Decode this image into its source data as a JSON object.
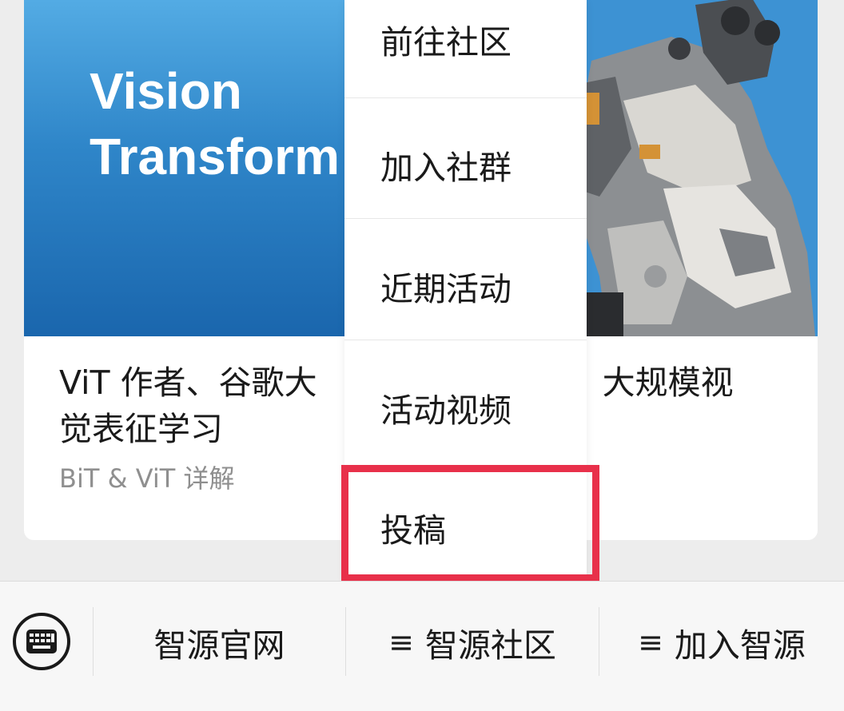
{
  "article": {
    "cover_line1": "Vision",
    "cover_line2": "Transform",
    "title": "ViT 作者、谷歌大脑研究员 Lucas Beyer：大规模视觉表征学习",
    "title_visible_left": "ViT 作者、谷歌大",
    "title_visible_right": "：大规模视",
    "title_line2": "觉表征学习",
    "subtitle": "BiT & ViT 详解"
  },
  "menu": {
    "items": [
      {
        "label": "前往社区"
      },
      {
        "label": "加入社群"
      },
      {
        "label": "近期活动"
      },
      {
        "label": "活动视频"
      },
      {
        "label": "投稿"
      }
    ],
    "highlighted_index": 4,
    "highlight_color": "#e8304a"
  },
  "bottom_bar": {
    "keyboard_icon": "keyboard-icon",
    "items": [
      {
        "label": "智源官网",
        "icon": ""
      },
      {
        "label": "智源社区",
        "icon": "≡"
      },
      {
        "label": "加入智源",
        "icon": "≡"
      }
    ]
  },
  "colors": {
    "cover_blue": "#2f86c9",
    "background": "#ededed"
  }
}
